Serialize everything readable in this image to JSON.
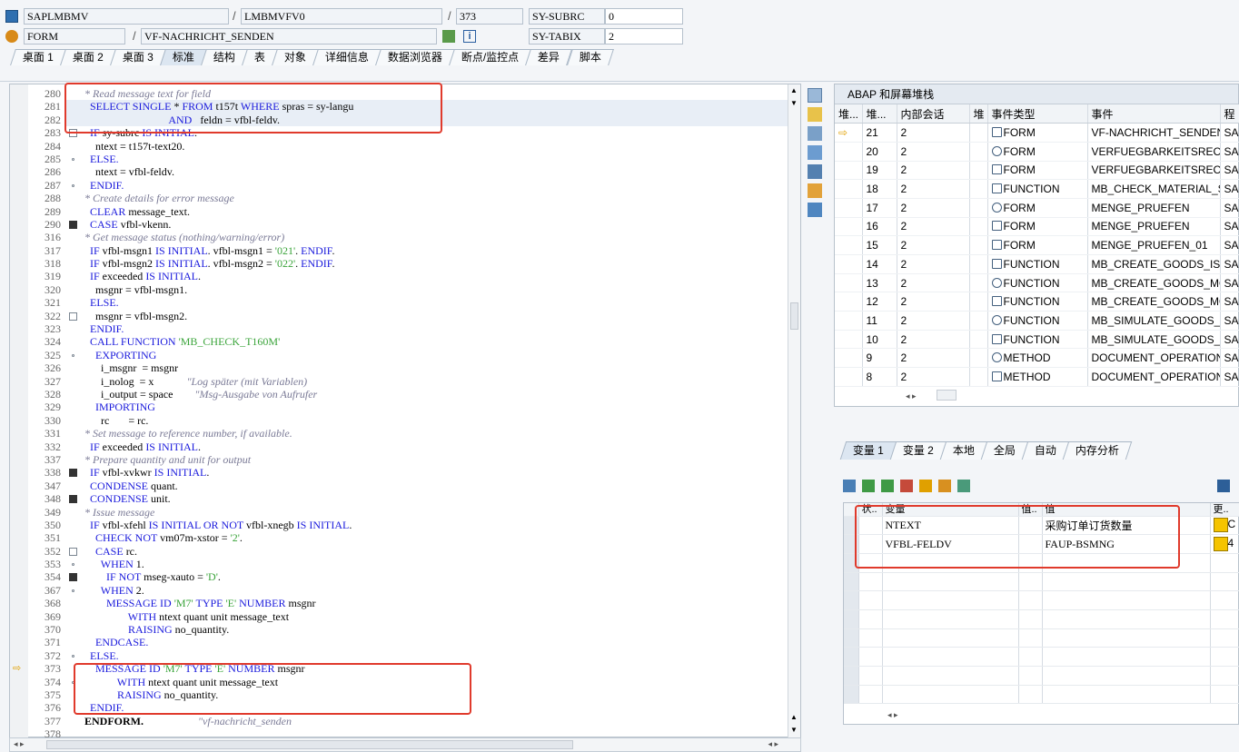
{
  "header": {
    "program": "SAPLMBMV",
    "include": "LMBMVFV0",
    "line": "373",
    "type": "FORM",
    "routine": "VF-NACHRICHT_SENDEN",
    "var1_name": "SY-SUBRC",
    "var1_val": "0",
    "var2_name": "SY-TABIX",
    "var2_val": "2"
  },
  "tabs": [
    "桌面 1",
    "桌面 2",
    "桌面 3",
    "标准",
    "结构",
    "表",
    "对象",
    "详细信息",
    "数据浏览器",
    "断点/监控点",
    "差异",
    "脚本"
  ],
  "active_tab": "标准",
  "code": [
    {
      "n": "280",
      "t": "* Read message text for field",
      "c": "com"
    },
    {
      "n": "281",
      "t": "  SELECT SINGLE * FROM t157t WHERE spras = sy-langu",
      "c": "mix"
    },
    {
      "n": "282",
      "t": "                               AND   feldn = vfbl-feldv.",
      "c": "mix"
    },
    {
      "n": "283",
      "t": "  IF sy-subrc IS INITIAL.",
      "c": "mix"
    },
    {
      "n": "284",
      "t": "    ntext = t157t-text20.",
      "c": "txt"
    },
    {
      "n": "285",
      "t": "  ELSE.",
      "c": "kw"
    },
    {
      "n": "286",
      "t": "    ntext = vfbl-feldv.",
      "c": "txt"
    },
    {
      "n": "287",
      "t": "  ENDIF.",
      "c": "kw"
    },
    {
      "n": "288",
      "t": "* Create details for error message",
      "c": "com"
    },
    {
      "n": "289",
      "t": "  CLEAR message_text.",
      "c": "mix"
    },
    {
      "n": "290",
      "t": "  CASE vfbl-vkenn.",
      "c": "mix"
    },
    {
      "n": "316",
      "t": "* Get message status (nothing/warning/error)",
      "c": "com"
    },
    {
      "n": "317",
      "t": "  IF vfbl-msgn1 IS INITIAL. vfbl-msgn1 = '021'. ENDIF.",
      "c": "mix"
    },
    {
      "n": "318",
      "t": "  IF vfbl-msgn2 IS INITIAL. vfbl-msgn2 = '022'. ENDIF.",
      "c": "mix"
    },
    {
      "n": "319",
      "t": "  IF exceeded IS INITIAL.",
      "c": "mix"
    },
    {
      "n": "320",
      "t": "    msgnr = vfbl-msgn1.",
      "c": "txt"
    },
    {
      "n": "321",
      "t": "  ELSE.",
      "c": "kw"
    },
    {
      "n": "322",
      "t": "    msgnr = vfbl-msgn2.",
      "c": "txt"
    },
    {
      "n": "323",
      "t": "  ENDIF.",
      "c": "kw"
    },
    {
      "n": "324",
      "t": "  CALL FUNCTION 'MB_CHECK_T160M'",
      "c": "mix"
    },
    {
      "n": "325",
      "t": "    EXPORTING",
      "c": "kw"
    },
    {
      "n": "326",
      "t": "      i_msgnr  = msgnr",
      "c": "txt"
    },
    {
      "n": "327",
      "t": "      i_nolog  = x            \"Log später (mit Variablen)",
      "c": "mix"
    },
    {
      "n": "328",
      "t": "      i_output = space        \"Msg-Ausgabe von Aufrufer",
      "c": "mix"
    },
    {
      "n": "329",
      "t": "    IMPORTING",
      "c": "kw"
    },
    {
      "n": "330",
      "t": "      rc       = rc.",
      "c": "txt"
    },
    {
      "n": "331",
      "t": "* Set message to reference number, if available.",
      "c": "com"
    },
    {
      "n": "332",
      "t": "  IF exceeded IS INITIAL.",
      "c": "mix"
    },
    {
      "n": "337",
      "t": "* Prepare quantity and unit for output",
      "c": "com"
    },
    {
      "n": "338",
      "t": "  IF vfbl-xvkwr IS INITIAL.",
      "c": "mix"
    },
    {
      "n": "347",
      "t": "  CONDENSE quant.",
      "c": "mix"
    },
    {
      "n": "348",
      "t": "  CONDENSE unit.",
      "c": "mix"
    },
    {
      "n": "349",
      "t": "* Issue message",
      "c": "com"
    },
    {
      "n": "350",
      "t": "  IF vfbl-xfehl IS INITIAL OR NOT vfbl-xnegb IS INITIAL.",
      "c": "mix"
    },
    {
      "n": "351",
      "t": "    CHECK NOT vm07m-xstor = '2'.",
      "c": "mix"
    },
    {
      "n": "352",
      "t": "    CASE rc.",
      "c": "mix"
    },
    {
      "n": "353",
      "t": "      WHEN 1.",
      "c": "mix"
    },
    {
      "n": "354",
      "t": "        IF NOT mseg-xauto = 'D'.",
      "c": "mix"
    },
    {
      "n": "367",
      "t": "      WHEN 2.",
      "c": "mix"
    },
    {
      "n": "368",
      "t": "        MESSAGE ID 'M7' TYPE 'E' NUMBER msgnr",
      "c": "mix"
    },
    {
      "n": "369",
      "t": "                WITH ntext quant unit message_text",
      "c": "mix"
    },
    {
      "n": "370",
      "t": "                RAISING no_quantity.",
      "c": "mix"
    },
    {
      "n": "371",
      "t": "    ENDCASE.",
      "c": "kw"
    },
    {
      "n": "372",
      "t": "  ELSE.",
      "c": "kw"
    },
    {
      "n": "373",
      "t": "    MESSAGE ID 'M7' TYPE 'E' NUMBER msgnr",
      "c": "mix"
    },
    {
      "n": "374",
      "t": "            WITH ntext quant unit message_text",
      "c": "mix"
    },
    {
      "n": "375",
      "t": "            RAISING no_quantity.",
      "c": "mix"
    },
    {
      "n": "376",
      "t": "  ENDIF.",
      "c": "kw"
    },
    {
      "n": "377",
      "t": "ENDFORM.                    \"vf-nachricht_senden",
      "c": "end"
    },
    {
      "n": "378",
      "t": "",
      "c": "txt"
    }
  ],
  "stack": {
    "title": "ABAP 和屏幕堆栈",
    "columns": [
      "堆...",
      "堆...",
      "内部会话",
      "堆",
      "事件类型",
      "事件",
      "程"
    ],
    "rows": [
      {
        "level": "21",
        "session": "2",
        "type": "FORM",
        "event": "VF-NACHRICHT_SENDEN",
        "prog": "SA",
        "current": true
      },
      {
        "level": "20",
        "session": "2",
        "type": "FORM",
        "event": "VERFUEGBARKEITSRECHN...",
        "prog": "SA"
      },
      {
        "level": "19",
        "session": "2",
        "type": "FORM",
        "event": "VERFUEGBARKEITSRECHN...",
        "prog": "SA"
      },
      {
        "level": "18",
        "session": "2",
        "type": "FUNCTION",
        "event": "MB_CHECK_MATERIAL_S...",
        "prog": "SA"
      },
      {
        "level": "17",
        "session": "2",
        "type": "FORM",
        "event": "MENGE_PRUEFEN",
        "prog": "SA"
      },
      {
        "level": "16",
        "session": "2",
        "type": "FORM",
        "event": "MENGE_PRUEFEN",
        "prog": "SA"
      },
      {
        "level": "15",
        "session": "2",
        "type": "FORM",
        "event": "MENGE_PRUEFEN_01",
        "prog": "SA"
      },
      {
        "level": "14",
        "session": "2",
        "type": "FUNCTION",
        "event": "MB_CREATE_GOODS_ISS...",
        "prog": "SA"
      },
      {
        "level": "13",
        "session": "2",
        "type": "FUNCTION",
        "event": "MB_CREATE_GOODS_MO...",
        "prog": "SA"
      },
      {
        "level": "12",
        "session": "2",
        "type": "FUNCTION",
        "event": "MB_CREATE_GOODS_MO...",
        "prog": "SA"
      },
      {
        "level": "11",
        "session": "2",
        "type": "FUNCTION",
        "event": "MB_SIMULATE_GOODS_M...",
        "prog": "SA"
      },
      {
        "level": "10",
        "session": "2",
        "type": "FUNCTION",
        "event": "MB_SIMULATE_GOODS_M...",
        "prog": "SA"
      },
      {
        "level": "9",
        "session": "2",
        "type": "METHOD",
        "event": "DOCUMENT_OPERATION",
        "prog": "SA"
      },
      {
        "level": "8",
        "session": "2",
        "type": "METHOD",
        "event": "DOCUMENT_OPERATION",
        "prog": "SA"
      }
    ]
  },
  "var_tabs": [
    "变量 1",
    "变量 2",
    "本地",
    "全局",
    "自动",
    "内存分析"
  ],
  "vars": {
    "columns": [
      "状..",
      "变量",
      "值..",
      "值",
      "更.."
    ],
    "rows": [
      {
        "name": "NTEXT",
        "value": "采购订单订货数量",
        "extra": "C"
      },
      {
        "name": "VFBL-FELDV",
        "value": "FAUP-BSMNG",
        "extra": "4"
      }
    ]
  },
  "colors": {
    "highlight": "#e03a2c",
    "keyword": "#1a1adc",
    "comment": "#7a7a96",
    "string": "#3aa43a"
  }
}
